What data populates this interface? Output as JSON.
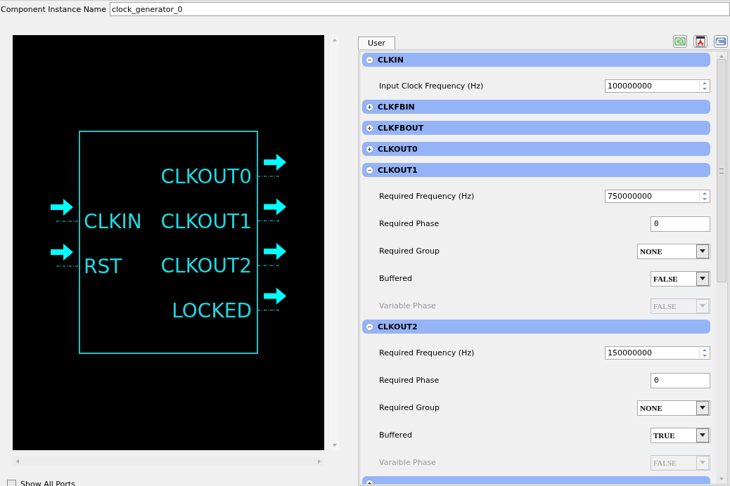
{
  "instance_name": {
    "label": "Component Instance Name",
    "value": "clock_generator_0"
  },
  "symbol": {
    "inputs": [
      "CLKIN",
      "RST"
    ],
    "outputs": [
      "CLKOUT0",
      "CLKOUT1",
      "CLKOUT2",
      "LOCKED"
    ]
  },
  "show_all_ports": {
    "label": "Show All Ports",
    "checked": false
  },
  "tabs": [
    {
      "label": "User",
      "selected": true
    }
  ],
  "sections": [
    {
      "title": "CLKIN",
      "expanded": true,
      "params": [
        {
          "kind": "spin",
          "label": "Input Clock Frequency (Hz)",
          "value": "100000000",
          "disabled": false
        }
      ]
    },
    {
      "title": "CLKFBIN",
      "expanded": false
    },
    {
      "title": "CLKFBOUT",
      "expanded": false
    },
    {
      "title": "CLKOUT0",
      "expanded": false
    },
    {
      "title": "CLKOUT1",
      "expanded": true,
      "params": [
        {
          "kind": "spin",
          "label": "Required Frequency (Hz)",
          "value": "750000000",
          "disabled": false
        },
        {
          "kind": "text",
          "label": "Required Phase",
          "value": "0",
          "disabled": false
        },
        {
          "kind": "select",
          "label": "Required Group",
          "value": "NONE",
          "disabled": false
        },
        {
          "kind": "select",
          "label": "Buffered",
          "value": "FALSE",
          "disabled": false
        },
        {
          "kind": "select",
          "label": "Variable Phase",
          "value": "FALSE",
          "disabled": true
        }
      ]
    },
    {
      "title": "CLKOUT2",
      "expanded": true,
      "params": [
        {
          "kind": "spin",
          "label": "Required Frequency (Hz)",
          "value": "150000000",
          "disabled": false
        },
        {
          "kind": "text",
          "label": "Required Phase",
          "value": "0",
          "disabled": false
        },
        {
          "kind": "select",
          "label": "Required Group",
          "value": "NONE",
          "disabled": false
        },
        {
          "kind": "select",
          "label": "Buffered",
          "value": "TRUE",
          "disabled": false
        },
        {
          "kind": "select",
          "label": "Varaible Phase",
          "value": "FALSE",
          "disabled": true
        }
      ]
    },
    {
      "expanded": false
    }
  ]
}
